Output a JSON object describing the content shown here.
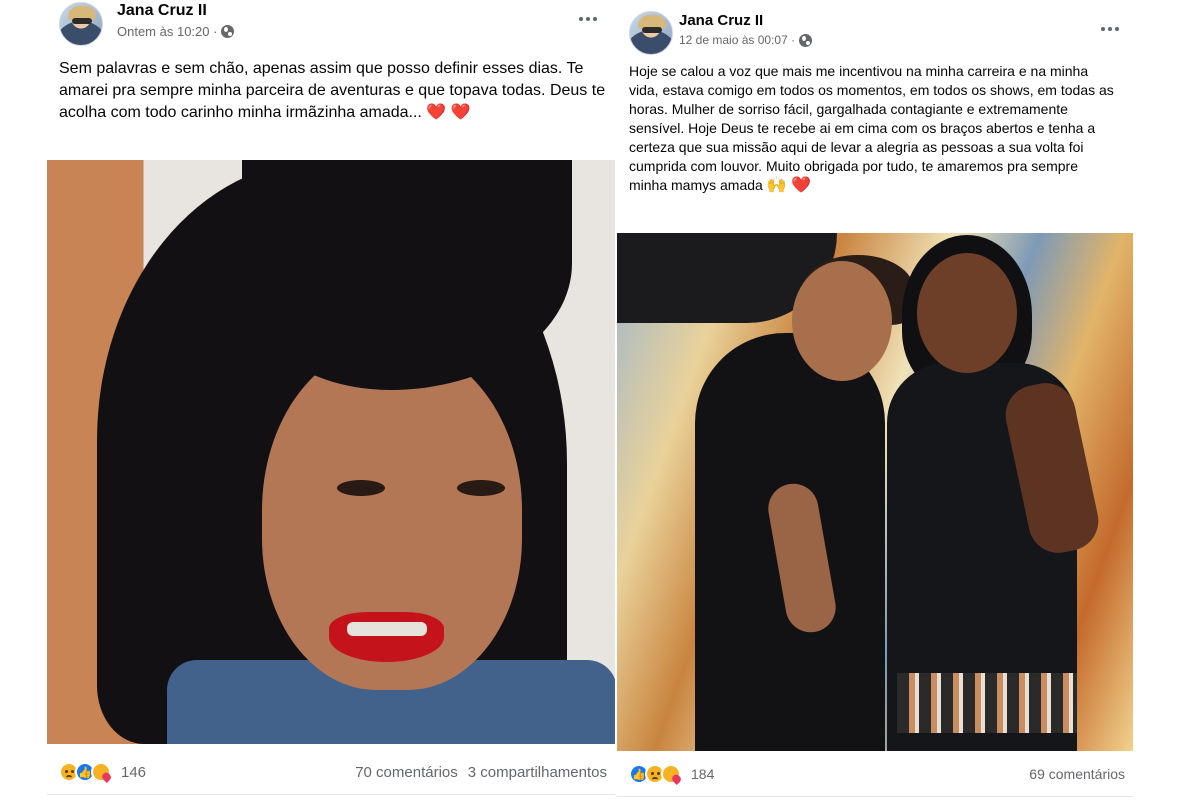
{
  "posts": [
    {
      "author": "Jana Cruz II",
      "timestamp": "Ontem às 10:20 ·",
      "text": "Sem palavras e sem chão, apenas assim que posso definir esses dias. Te amarei pra sempre minha parceira de aventuras e que topava todas. Deus te acolha com todo carinho minha irmãzinha amada...",
      "emoji_suffix": "❤️ ❤️",
      "reaction_icons": [
        "sad-reaction-icon",
        "like-reaction-icon",
        "care-reaction-icon"
      ],
      "reaction_count": "146",
      "comments": "70 comentários",
      "shares": "3 compartilhamentos"
    },
    {
      "author": "Jana Cruz II",
      "timestamp": "12 de maio às 00:07 ·",
      "text": "Hoje se calou a voz que mais me incentivou na minha carreira e na minha vida, estava comigo em todos os momentos, em todos os shows, em todas as horas.  Mulher de sorriso fácil, gargalhada contagiante e extremamente sensível. Hoje Deus te recebe ai em cima com os braços abertos e tenha a certeza que sua missão aqui de levar a alegria as pessoas a sua volta foi cumprida com louvor. Muito obrigada por tudo,  te amaremos pra sempre minha mamys amada",
      "emoji_suffix": "🙌 ❤️",
      "reaction_icons": [
        "like-reaction-icon",
        "sad-reaction-icon",
        "care-reaction-icon"
      ],
      "reaction_count": "184",
      "comments": "69 comentários"
    }
  ],
  "colors": {
    "author_text": "#050505",
    "meta_text": "#65676b",
    "like_blue": "#1877f2",
    "reaction_yellow": "#f7b125",
    "heart_red": "#e8365d"
  }
}
